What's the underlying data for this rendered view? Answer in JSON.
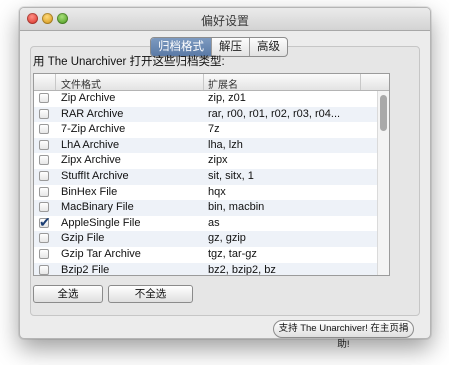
{
  "window": {
    "title": "偏好设置"
  },
  "tabs": [
    {
      "label": "归档格式",
      "selected": true
    },
    {
      "label": "解压",
      "selected": false
    },
    {
      "label": "高级",
      "selected": false
    }
  ],
  "prompt": "用 The Unarchiver 打开这些归档类型:",
  "table": {
    "columns": [
      "文件格式",
      "扩展名"
    ],
    "rows": [
      {
        "format": "Zip Archive",
        "ext": "zip, z01",
        "checked": false
      },
      {
        "format": "RAR Archive",
        "ext": "rar, r00, r01, r02, r03, r04...",
        "checked": false
      },
      {
        "format": "7-Zip Archive",
        "ext": "7z",
        "checked": false
      },
      {
        "format": "LhA Archive",
        "ext": "lha, lzh",
        "checked": false
      },
      {
        "format": "Zipx Archive",
        "ext": "zipx",
        "checked": false
      },
      {
        "format": "StuffIt Archive",
        "ext": "sit, sitx, 1",
        "checked": false
      },
      {
        "format": "BinHex File",
        "ext": "hqx",
        "checked": false
      },
      {
        "format": "MacBinary File",
        "ext": "bin, macbin",
        "checked": false
      },
      {
        "format": "AppleSingle File",
        "ext": "as",
        "checked": true
      },
      {
        "format": "Gzip File",
        "ext": "gz, gzip",
        "checked": false
      },
      {
        "format": "Gzip Tar Archive",
        "ext": "tgz, tar-gz",
        "checked": false
      },
      {
        "format": "Bzip2 File",
        "ext": "bz2, bzip2, bz",
        "checked": false
      }
    ]
  },
  "buttons": {
    "select_all": "全选",
    "select_none": "不全选",
    "donate": "支持 The Unarchiver! 在主页捐助!"
  },
  "colors": {
    "selected_tab": "#5a7aa6",
    "row_alt": "#eef2f8"
  }
}
